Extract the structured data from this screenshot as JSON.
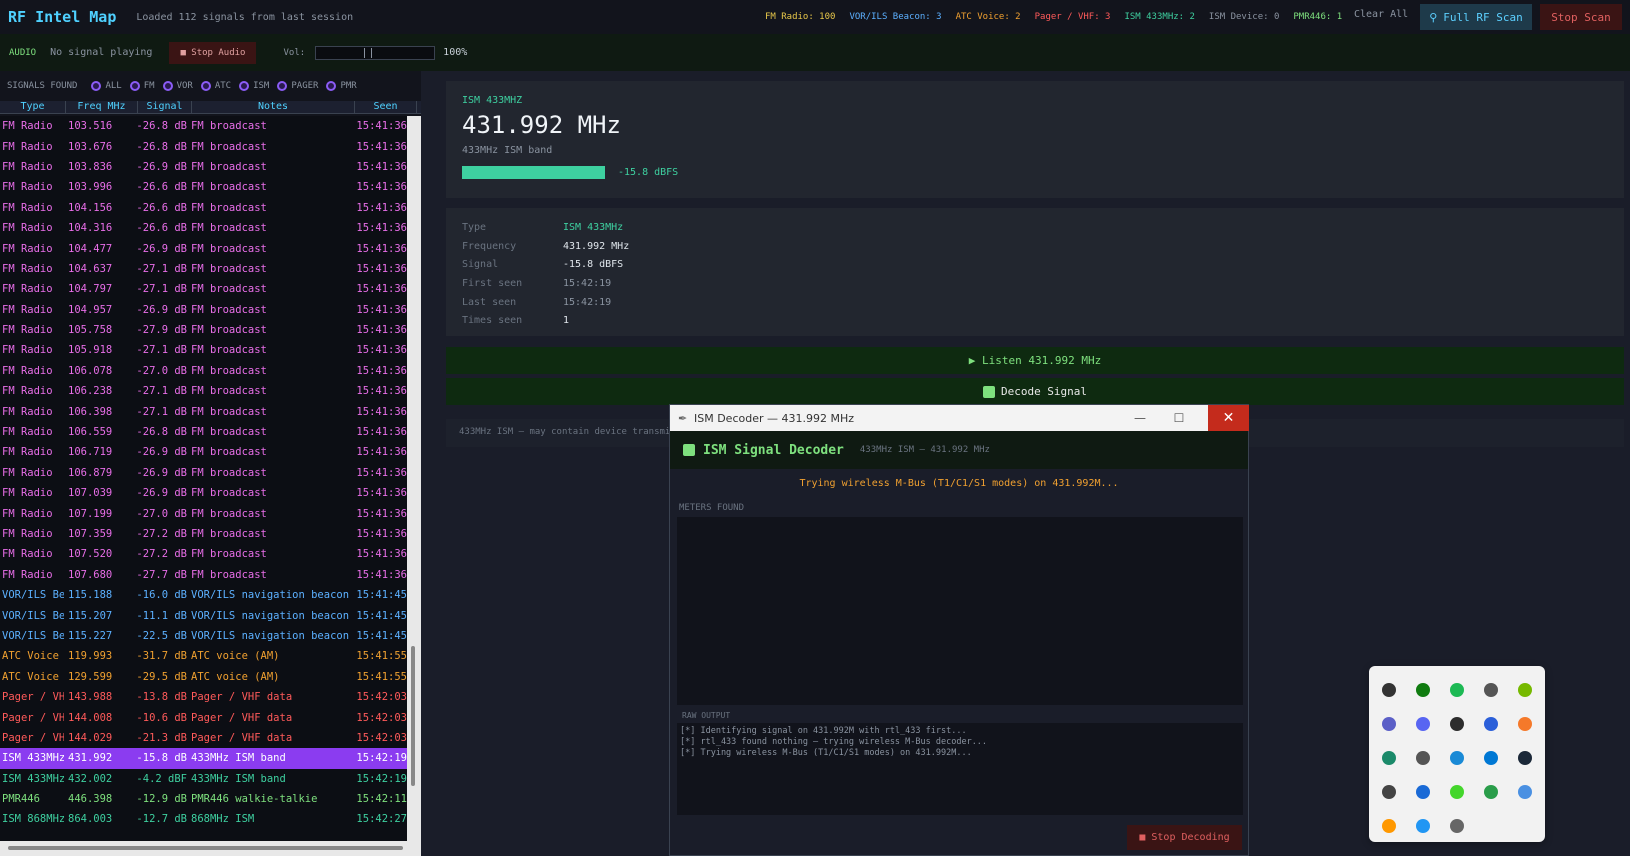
{
  "header": {
    "title": "RF Intel Map",
    "status": "Loaded 112 signals from last session",
    "counts": [
      {
        "label": "FM Radio: 100",
        "color": "#e8c84a"
      },
      {
        "label": "VOR/ILS Beacon: 3",
        "color": "#5cb0ff"
      },
      {
        "label": "ATC Voice: 2",
        "color": "#f0a030"
      },
      {
        "label": "Pager / VHF: 3",
        "color": "#ff5a5a"
      },
      {
        "label": "ISM 433MHz: 2",
        "color": "#3ed0a0"
      },
      {
        "label": "ISM Device: 0",
        "color": "#8a93a0"
      },
      {
        "label": "PMR446: 1",
        "color": "#7ee07e"
      }
    ],
    "clear_label": "Clear All",
    "scan_label": "Full RF Scan",
    "stop_scan_label": "Stop Scan"
  },
  "audio": {
    "label": "AUDIO",
    "status": "No signal playing",
    "stop_label": "■ Stop Audio",
    "vol_label": "Vol:",
    "vol_pct": "100%"
  },
  "filters": {
    "label": "SIGNALS FOUND",
    "items": [
      "ALL",
      "FM",
      "VOR",
      "ATC",
      "ISM",
      "PAGER",
      "PMR"
    ]
  },
  "table": {
    "headers": [
      "Type",
      "Freq MHz",
      "Signal",
      "Notes",
      "Seen"
    ],
    "rows": [
      {
        "type": "FM Radio",
        "freq": "103.516",
        "sig": "-26.8 dB",
        "notes": "FM broadcast",
        "seen": "15:41:36",
        "color": "#e86ee8"
      },
      {
        "type": "FM Radio",
        "freq": "103.676",
        "sig": "-26.8 dB",
        "notes": "FM broadcast",
        "seen": "15:41:36",
        "color": "#e86ee8"
      },
      {
        "type": "FM Radio",
        "freq": "103.836",
        "sig": "-26.9 dB",
        "notes": "FM broadcast",
        "seen": "15:41:36",
        "color": "#e86ee8"
      },
      {
        "type": "FM Radio",
        "freq": "103.996",
        "sig": "-26.6 dB",
        "notes": "FM broadcast",
        "seen": "15:41:36",
        "color": "#e86ee8"
      },
      {
        "type": "FM Radio",
        "freq": "104.156",
        "sig": "-26.6 dB",
        "notes": "FM broadcast",
        "seen": "15:41:36",
        "color": "#e86ee8"
      },
      {
        "type": "FM Radio",
        "freq": "104.316",
        "sig": "-26.6 dB",
        "notes": "FM broadcast",
        "seen": "15:41:36",
        "color": "#e86ee8"
      },
      {
        "type": "FM Radio",
        "freq": "104.477",
        "sig": "-26.9 dB",
        "notes": "FM broadcast",
        "seen": "15:41:36",
        "color": "#e86ee8"
      },
      {
        "type": "FM Radio",
        "freq": "104.637",
        "sig": "-27.1 dB",
        "notes": "FM broadcast",
        "seen": "15:41:36",
        "color": "#e86ee8"
      },
      {
        "type": "FM Radio",
        "freq": "104.797",
        "sig": "-27.1 dB",
        "notes": "FM broadcast",
        "seen": "15:41:36",
        "color": "#e86ee8"
      },
      {
        "type": "FM Radio",
        "freq": "104.957",
        "sig": "-26.9 dB",
        "notes": "FM broadcast",
        "seen": "15:41:36",
        "color": "#e86ee8"
      },
      {
        "type": "FM Radio",
        "freq": "105.758",
        "sig": "-27.9 dB",
        "notes": "FM broadcast",
        "seen": "15:41:36",
        "color": "#e86ee8"
      },
      {
        "type": "FM Radio",
        "freq": "105.918",
        "sig": "-27.1 dB",
        "notes": "FM broadcast",
        "seen": "15:41:36",
        "color": "#e86ee8"
      },
      {
        "type": "FM Radio",
        "freq": "106.078",
        "sig": "-27.0 dB",
        "notes": "FM broadcast",
        "seen": "15:41:36",
        "color": "#e86ee8"
      },
      {
        "type": "FM Radio",
        "freq": "106.238",
        "sig": "-27.1 dB",
        "notes": "FM broadcast",
        "seen": "15:41:36",
        "color": "#e86ee8"
      },
      {
        "type": "FM Radio",
        "freq": "106.398",
        "sig": "-27.1 dB",
        "notes": "FM broadcast",
        "seen": "15:41:36",
        "color": "#e86ee8"
      },
      {
        "type": "FM Radio",
        "freq": "106.559",
        "sig": "-26.8 dB",
        "notes": "FM broadcast",
        "seen": "15:41:36",
        "color": "#e86ee8"
      },
      {
        "type": "FM Radio",
        "freq": "106.719",
        "sig": "-26.9 dB",
        "notes": "FM broadcast",
        "seen": "15:41:36",
        "color": "#e86ee8"
      },
      {
        "type": "FM Radio",
        "freq": "106.879",
        "sig": "-26.9 dB",
        "notes": "FM broadcast",
        "seen": "15:41:36",
        "color": "#e86ee8"
      },
      {
        "type": "FM Radio",
        "freq": "107.039",
        "sig": "-26.9 dB",
        "notes": "FM broadcast",
        "seen": "15:41:36",
        "color": "#e86ee8"
      },
      {
        "type": "FM Radio",
        "freq": "107.199",
        "sig": "-27.0 dB",
        "notes": "FM broadcast",
        "seen": "15:41:36",
        "color": "#e86ee8"
      },
      {
        "type": "FM Radio",
        "freq": "107.359",
        "sig": "-27.2 dB",
        "notes": "FM broadcast",
        "seen": "15:41:36",
        "color": "#e86ee8"
      },
      {
        "type": "FM Radio",
        "freq": "107.520",
        "sig": "-27.2 dB",
        "notes": "FM broadcast",
        "seen": "15:41:36",
        "color": "#e86ee8"
      },
      {
        "type": "FM Radio",
        "freq": "107.680",
        "sig": "-27.7 dB",
        "notes": "FM broadcast",
        "seen": "15:41:36",
        "color": "#e86ee8"
      },
      {
        "type": "VOR/ILS Be:",
        "freq": "115.188",
        "sig": "-16.0 dB",
        "notes": "VOR/ILS navigation beacon",
        "seen": "15:41:45",
        "color": "#5cb0ff"
      },
      {
        "type": "VOR/ILS Be:",
        "freq": "115.207",
        "sig": "-11.1 dB",
        "notes": "VOR/ILS navigation beacon",
        "seen": "15:41:45",
        "color": "#5cb0ff"
      },
      {
        "type": "VOR/ILS Be:",
        "freq": "115.227",
        "sig": "-22.5 dB",
        "notes": "VOR/ILS navigation beacon",
        "seen": "15:41:45",
        "color": "#5cb0ff"
      },
      {
        "type": "ATC Voice",
        "freq": "119.993",
        "sig": "-31.7 dB",
        "notes": "ATC voice (AM)",
        "seen": "15:41:55",
        "color": "#f0a030"
      },
      {
        "type": "ATC Voice",
        "freq": "129.599",
        "sig": "-29.5 dB",
        "notes": "ATC voice (AM)",
        "seen": "15:41:55",
        "color": "#f0a030"
      },
      {
        "type": "Pager / VH",
        "freq": "143.988",
        "sig": "-13.8 dB",
        "notes": "Pager / VHF data",
        "seen": "15:42:03",
        "color": "#ff5a5a"
      },
      {
        "type": "Pager / VH",
        "freq": "144.008",
        "sig": "-10.6 dB",
        "notes": "Pager / VHF data",
        "seen": "15:42:03",
        "color": "#ff5a5a"
      },
      {
        "type": "Pager / VH",
        "freq": "144.029",
        "sig": "-21.3 dB",
        "notes": "Pager / VHF data",
        "seen": "15:42:03",
        "color": "#ff5a5a"
      },
      {
        "type": "ISM 433MHz",
        "freq": "431.992",
        "sig": "-15.8 dB",
        "notes": "433MHz ISM band",
        "seen": "15:42:19",
        "color": "#ffffff",
        "selected": true
      },
      {
        "type": "ISM 433MHz",
        "freq": "432.002",
        "sig": "-4.2 dBF",
        "notes": "433MHz ISM band",
        "seen": "15:42:19",
        "color": "#3ed0a0"
      },
      {
        "type": "PMR446",
        "freq": "446.398",
        "sig": "-12.9 dB",
        "notes": "PMR446 walkie-talkie",
        "seen": "15:42:11",
        "color": "#7ee07e"
      },
      {
        "type": "ISM 868MHz",
        "freq": "864.003",
        "sig": "-12.7 dB",
        "notes": "868MHz ISM",
        "seen": "15:42:27",
        "color": "#3ed0a0"
      }
    ]
  },
  "detail": {
    "type": "ISM 433MHZ",
    "freq": "431.992 MHz",
    "desc": "433MHz ISM band",
    "signal_label": "-15.8 dBFS",
    "info": [
      {
        "key": "Type",
        "val": "ISM 433MHz",
        "color": "#3ed0a0"
      },
      {
        "key": "Frequency",
        "val": "431.992 MHz",
        "color": "#e0e6ec"
      },
      {
        "key": "Signal",
        "val": "-15.8 dBFS",
        "color": "#e0e6ec"
      },
      {
        "key": "First seen",
        "val": "15:42:19",
        "color": "#8a93a0"
      },
      {
        "key": "Last seen",
        "val": "15:42:19",
        "color": "#8a93a0"
      },
      {
        "key": "Times seen",
        "val": "1",
        "color": "#e0e6ec"
      }
    ],
    "listen_label": "▶ Listen  431.992 MHz",
    "decode_label": "Decode Signal",
    "note": "433MHz ISM — may contain device transmiss"
  },
  "decoder": {
    "window_title": "ISM Decoder — 431.992 MHz",
    "title": "ISM Signal Decoder",
    "subtitle": "433MHz ISM  —  431.992 MHz",
    "status": "Trying wireless M-Bus (T1/C1/S1 modes) on 431.992M...",
    "meters_label": "METERS FOUND",
    "raw_label": "RAW OUTPUT",
    "raw_lines": [
      "[*] Identifying signal on 431.992M with rtl_433 first...",
      "[*] rtl_433 found nothing — trying wireless M-Bus decoder...",
      "[*] Trying wireless M-Bus (T1/C1/S1 modes) on 431.992M..."
    ],
    "stop_label": "■ Stop Decoding"
  },
  "tray": {
    "icons": [
      {
        "name": "app-icon",
        "color": "#333333"
      },
      {
        "name": "xbox-icon",
        "color": "#107c10"
      },
      {
        "name": "spotify-icon",
        "color": "#1db954"
      },
      {
        "name": "chatgpt-icon",
        "color": "#555555"
      },
      {
        "name": "nvidia-icon",
        "color": "#76b900"
      },
      {
        "name": "zoom-icon",
        "color": "#5b5fc7"
      },
      {
        "name": "discord-icon",
        "color": "#5865f2"
      },
      {
        "name": "terminal-icon",
        "color": "#2d2d2d"
      },
      {
        "name": "malwarebytes-icon",
        "color": "#2b5fd9"
      },
      {
        "name": "blender-icon",
        "color": "#f5792a"
      },
      {
        "name": "steam-alt-icon",
        "color": "#1b8a6a"
      },
      {
        "name": "usb-icon",
        "color": "#555555"
      },
      {
        "name": "shield-icon",
        "color": "#1a8ad6"
      },
      {
        "name": "bluetooth-icon",
        "color": "#0078d4"
      },
      {
        "name": "steam-icon",
        "color": "#1b2838"
      },
      {
        "name": "copy-icon",
        "color": "#444444"
      },
      {
        "name": "lifesaver-icon",
        "color": "#1a6ad6"
      },
      {
        "name": "razer-icon",
        "color": "#44d62c"
      },
      {
        "name": "headset-icon",
        "color": "#2a9d4a"
      },
      {
        "name": "globe-icon",
        "color": "#4a90e2"
      },
      {
        "name": "sublime-icon",
        "color": "#ff9800"
      },
      {
        "name": "window-icon",
        "color": "#2196f3"
      },
      {
        "name": "menu-icon",
        "color": "#666666"
      }
    ]
  }
}
